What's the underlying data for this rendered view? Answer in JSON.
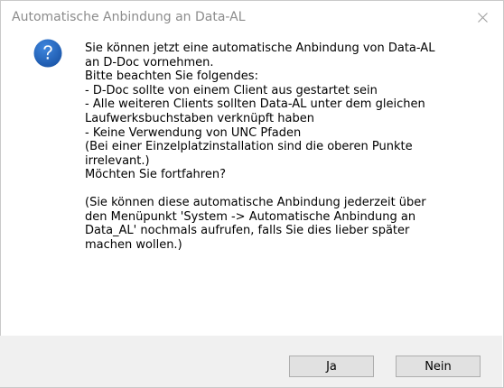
{
  "window": {
    "title": "Automatische Anbindung an Data-AL",
    "close_icon": "close-icon"
  },
  "dialog": {
    "icon": "question-icon",
    "message_lines": [
      "Sie können jetzt eine automatische Anbindung von Data-AL",
      "an D-Doc vornehmen.",
      "Bitte beachten Sie folgendes:",
      "- D-Doc sollte von einem Client aus gestartet sein",
      "- Alle weiteren Clients sollten Data-AL unter dem gleichen",
      "Laufwerksbuchstaben verknüpft haben",
      "- Keine Verwendung von UNC Pfaden",
      "(Bei einer Einzelplatzinstallation sind die oberen Punkte",
      "irrelevant.)",
      "Möchten Sie fortfahren?"
    ],
    "note_lines": [
      "(Sie können diese automatische Anbindung jederzeit über",
      "den Menüpunkt 'System -> Automatische Anbindung an",
      "Data_AL' nochmals aufrufen, falls Sie dies lieber später",
      "machen wollen.)"
    ]
  },
  "buttons": {
    "yes_label": "Ja",
    "no_label": "Nein"
  },
  "colors": {
    "icon_blue": "#1c5db5",
    "footer_bg": "#f0f0f0",
    "button_bg": "#e1e1e1"
  }
}
